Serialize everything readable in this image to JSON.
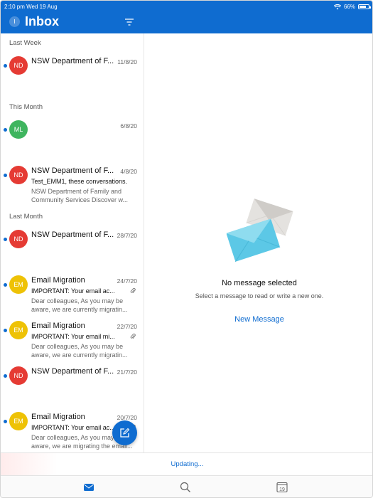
{
  "status_bar": {
    "time": "2:10 pm  Wed 19 Aug",
    "battery": "66%"
  },
  "header": {
    "title": "Inbox",
    "account_initial": "I"
  },
  "sections": {
    "last_week": "Last Week",
    "this_month": "This Month",
    "last_month": "Last Month"
  },
  "messages": [
    {
      "initials": "ND",
      "sender": "NSW Department of F...",
      "date": "11/8/20",
      "subject": "",
      "preview": "",
      "unread": true,
      "avatar_color": "#e53b34"
    },
    {
      "initials": "ML",
      "sender": "",
      "date": "6/8/20",
      "subject": "",
      "preview": "",
      "unread": true,
      "avatar_color": "#3fb55f"
    },
    {
      "initials": "ND",
      "sender": "NSW Department of F...",
      "date": "4/8/20",
      "subject": "Test_EMM1, these conversations...",
      "preview": "NSW Department of Family and Community Services Discover w...",
      "unread": true,
      "avatar_color": "#e53b34"
    },
    {
      "initials": "ND",
      "sender": "NSW Department of F...",
      "date": "28/7/20",
      "subject": "",
      "preview": "",
      "unread": true,
      "avatar_color": "#e53b34"
    },
    {
      "initials": "EM",
      "sender": "Email Migration",
      "date": "24/7/20",
      "subject": "IMPORTANT: Your email ac...",
      "preview": "Dear colleagues, As you may be aware, we are currently migratin...",
      "unread": true,
      "attachment": true,
      "avatar_color": "#eec206"
    },
    {
      "initials": "EM",
      "sender": "Email Migration",
      "date": "22/7/20",
      "subject": "IMPORTANT: Your email mi...",
      "preview": "Dear colleagues, As you may be aware, we are currently migratin...",
      "unread": true,
      "attachment": true,
      "avatar_color": "#eec206"
    },
    {
      "initials": "ND",
      "sender": "NSW Department of F...",
      "date": "21/7/20",
      "subject": "",
      "preview": "",
      "unread": true,
      "avatar_color": "#e53b34"
    },
    {
      "initials": "EM",
      "sender": "Email Migration",
      "date": "20/7/20",
      "subject": "IMPORTANT: Your email ac...",
      "preview": "Dear colleagues, As you may be aware, we are migrating the email...",
      "unread": true,
      "attachment": true,
      "avatar_color": "#eec206"
    }
  ],
  "reading_pane": {
    "title": "No message selected",
    "subtitle": "Select a message to read or write a new one.",
    "new_message": "New Message"
  },
  "bottom": {
    "updating": "Updating...",
    "calendar_day": "19",
    "tabs": [
      "mail-icon",
      "search-icon",
      "calendar-icon"
    ]
  },
  "colors": {
    "accent": "#0f6cd0",
    "red": "#e53b34",
    "green": "#3fb55f",
    "yellow": "#eec206"
  }
}
